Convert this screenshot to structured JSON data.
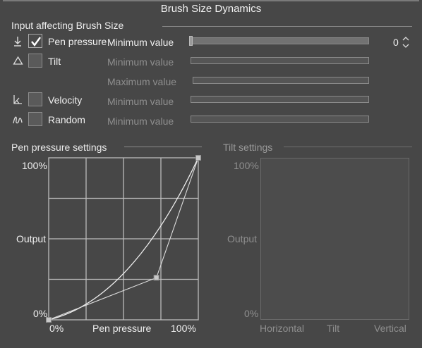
{
  "window": {
    "title": "Brush Size Dynamics"
  },
  "input_section": {
    "heading": "Input affecting Brush Size"
  },
  "rows": {
    "pen_pressure": {
      "label": "Pen pressure",
      "checked": true,
      "field": "Minimum value",
      "value": "0"
    },
    "tilt": {
      "label": "Tilt",
      "checked": false,
      "field_min": "Minimum value",
      "field_max": "Maximum value"
    },
    "velocity": {
      "label": "Velocity",
      "checked": false,
      "field": "Minimum value"
    },
    "random": {
      "label": "Random",
      "checked": false,
      "field": "Minimum value"
    }
  },
  "pen_pressure_graph": {
    "heading": "Pen pressure settings",
    "y_top": "100%",
    "y_mid": "Output",
    "y_bottom": "0%",
    "x_left": "0%",
    "x_mid": "Pen pressure",
    "x_right": "100%",
    "control_points": [
      {
        "input": 0,
        "output": 0
      },
      {
        "input": 0.72,
        "output": 0.26
      },
      {
        "input": 1,
        "output": 1
      }
    ]
  },
  "tilt_graph": {
    "heading": "Tilt settings",
    "y_top": "100%",
    "y_mid": "Output",
    "y_bottom": "0%",
    "x_left": "Horizontal",
    "x_mid": "Tilt",
    "x_right": "Vertical"
  },
  "icons": {
    "pen_pressure": "pen-pressure-icon",
    "tilt": "tilt-icon",
    "velocity": "velocity-icon",
    "random": "random-icon",
    "spinner": "spinner-icon"
  }
}
